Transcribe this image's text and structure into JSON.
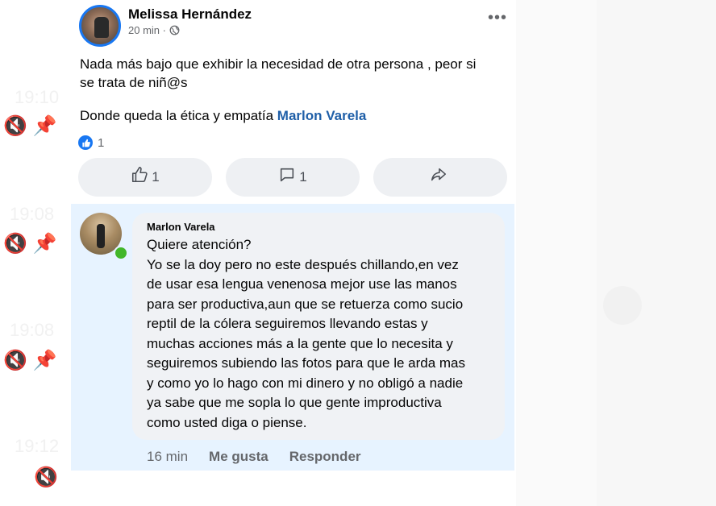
{
  "post": {
    "author": "Melissa Hernández",
    "time": "20 min",
    "separator": "·",
    "privacy_icon": "globe-icon",
    "more_icon": "more-horizontal-icon",
    "text_line1": "Nada más bajo que exhibir la necesidad de otra persona , peor si",
    "text_line2": "se trata de niñ@s",
    "text_line3": "Donde queda la ética y empatía ",
    "mention": "Marlon Varela",
    "reaction_count": "1",
    "like_count": "1",
    "comment_count": "1"
  },
  "comment": {
    "author": "Marlon Varela",
    "lines": [
      "Quiere atención?",
      "Yo se la doy pero no este después chillando,en vez",
      "de usar esa lengua venenosa mejor use las manos",
      "para ser productiva,aun que se retuerza como sucio",
      "reptil de la cólera seguiremos llevando estas y",
      "muchas acciones más a la gente que lo necesita y",
      "seguiremos subiendo las fotos para que le arda mas",
      "y como yo lo hago con mi dinero y no obligó a nadie",
      "ya sabe que me sopla lo que gente improductiva",
      "como usted diga o piense."
    ],
    "time": "16 min",
    "like_label": "Me gusta",
    "reply_label": "Responder"
  },
  "background": {
    "times": [
      "19:10",
      "19:08",
      "19:08",
      "19:12"
    ]
  },
  "colors": {
    "accent": "#1877f2",
    "mention": "#1f5fa8",
    "comment_highlight": "#e7f3ff",
    "online": "#42b72a"
  }
}
